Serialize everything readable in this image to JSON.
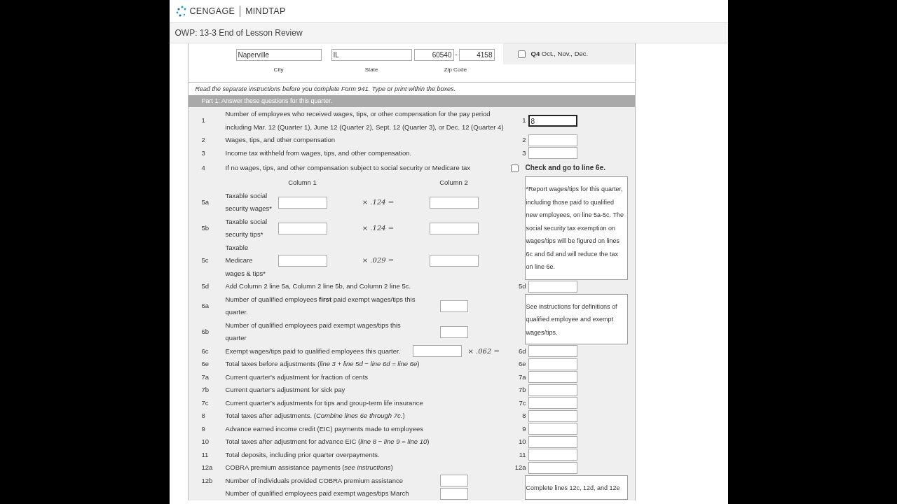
{
  "brand": {
    "left": "CENGAGE",
    "right": "MINDTAP"
  },
  "title": "OWP: 13-3 End of Lesson Review",
  "address": {
    "city": {
      "value": "Naperville",
      "label": "City"
    },
    "state": {
      "value": "IL",
      "label": "State"
    },
    "zip": {
      "value": "60540",
      "extension": "4158",
      "separator": "-",
      "label": "Zip Code"
    }
  },
  "quarter": {
    "checked": false,
    "label": "Q4",
    "text": "Oct., Nov., Dec."
  },
  "instructions": "Read the separate instructions before you complete Form 941. Type or print within the boxes.",
  "part_title": "Part 1: Answer these questions for this quarter.",
  "sections": [
    {
      "kind": "field",
      "number": "1",
      "text": "Number of employees who received wages, tips, or other compensation for the pay period including Mar. 12 (Quarter 1), June 12 (Quarter 2), Sept. 12 (Quarter 3), or Dec. 12 (Quarter 4)",
      "field_label": "1",
      "value": "8"
    },
    {
      "kind": "field",
      "number": "2",
      "text": "Wages, tips, and other compensation",
      "field_label": "2"
    },
    {
      "kind": "field",
      "number": "3",
      "text": "Income tax withheld from wages, tips, and other compensation.",
      "field_label": "3"
    },
    {
      "kind": "check",
      "number": "4",
      "text": "If no wages, tips, and other compensation subject to social security or Medicare tax",
      "checked": false,
      "check_label": "Check and go to line 6e."
    },
    {
      "kind": "columns",
      "headers": [
        "Column 1",
        "Column 2"
      ],
      "note": "*Report wages/tips for this quarter, including those paid to qualified new employees, on line 5a-5c. The social security tax exemption on wages/tips will be figured on lines 6c and 6d and will reduce the tax on line 6e.",
      "rows": [
        {
          "number": "5a",
          "text": "Taxable social security wages*",
          "multiplier": "× *.124* ="
        },
        {
          "number": "5b",
          "text": "Taxable social security tips*",
          "multiplier": "× *.124* ="
        },
        {
          "number": "5c",
          "text": "Taxable Medicare wages & tips*",
          "multiplier": "× *.029* ="
        }
      ]
    },
    {
      "kind": "field",
      "number": "5d",
      "text": "Add Column 2 line 5a, Column 2 line 5b, and Column 2 line 5c.",
      "field_label": "5d"
    },
    {
      "kind": "counts",
      "note": "See instructions for definitions of qualified employee and exempt wages/tips.",
      "rows": [
        {
          "number": "6a",
          "text": "Number of qualified employees **first** paid exempt wages/tips this quarter."
        },
        {
          "number": "6b",
          "text": "Number of qualified employees paid exempt wages/tips this quarter"
        }
      ]
    },
    {
      "kind": "multiply",
      "number": "6c",
      "text": "Exempt wages/tips paid to qualified employees this quarter.",
      "multiplier": "× *.062* =",
      "field_label": "6d"
    },
    {
      "kind": "field",
      "number": "6e",
      "text": "Total taxes before adjustments (*line 3 + line 5d − line 6d = line 6e*)",
      "field_label": "6e"
    },
    {
      "kind": "field",
      "number": "7a",
      "text": "Current quarter's adjustment for fraction of cents",
      "field_label": "7a"
    },
    {
      "kind": "field",
      "number": "7b",
      "text": "Current quarter's adjustment for sick pay",
      "field_label": "7b"
    },
    {
      "kind": "field",
      "number": "7c",
      "text": "Current quarter's adjustments for tips and group-term life insurance",
      "field_label": "7c"
    },
    {
      "kind": "field",
      "number": "8",
      "text": "Total taxes after adjustments. (*Combine lines 6e through 7c.*)",
      "field_label": "8"
    },
    {
      "kind": "field",
      "number": "9",
      "text": "Advance earned income credit (EIC) payments made to employees",
      "field_label": "9"
    },
    {
      "kind": "field",
      "number": "10",
      "text": "Total taxes after adjustment for advance EIC (*line 8 − line 9 = line 10*)",
      "field_label": "10"
    },
    {
      "kind": "field",
      "number": "11",
      "text": "Total deposits, including prior quarter overpayments.",
      "field_label": "11"
    },
    {
      "kind": "field",
      "number": "12a",
      "text": "COBRA premium assistance payments (*see instructions*)",
      "field_label": "12a"
    },
    {
      "kind": "counts",
      "note": "Complete lines 12c, 12d, and 12e",
      "rows": [
        {
          "number": "12b",
          "text": "Number of individuals provided COBRA premium assistance"
        },
        {
          "number": "",
          "text": "Number of qualified employees paid exempt wages/tips March"
        }
      ]
    }
  ]
}
